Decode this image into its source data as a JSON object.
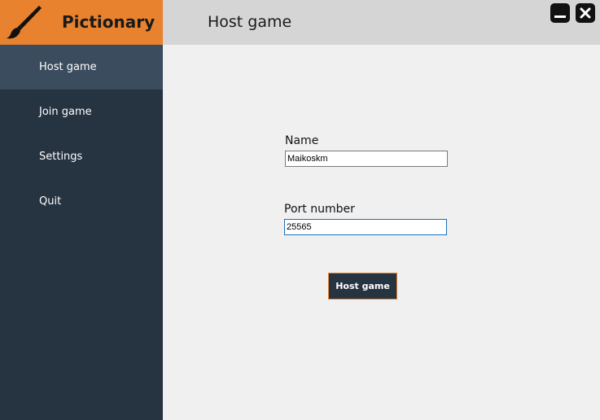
{
  "app": {
    "name": "Pictionary",
    "brand_icon": "paintbrush-icon",
    "brand_color": "#e8822f",
    "sidebar_color": "#263340",
    "active_item_color": "#3b4c5e"
  },
  "sidebar": {
    "items": [
      {
        "label": "Host game",
        "active": true
      },
      {
        "label": "Join game",
        "active": false
      },
      {
        "label": "Settings",
        "active": false
      },
      {
        "label": "Quit",
        "active": false
      }
    ]
  },
  "header": {
    "title": "Host game"
  },
  "window_controls": {
    "minimize_icon": "minimize-icon",
    "close_icon": "close-icon"
  },
  "form": {
    "name_label": "Name",
    "name_value": "Maikoskm",
    "port_label": "Port number",
    "port_value": "25565",
    "submit_label": "Host game"
  }
}
